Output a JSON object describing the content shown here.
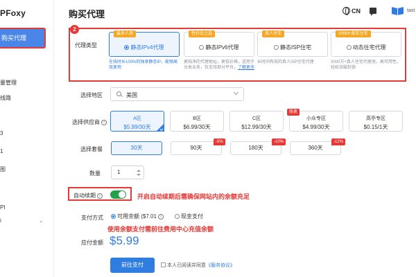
{
  "brand": {
    "logo_text": "PFoxy"
  },
  "sidebar": {
    "active_item": "购买代理",
    "items": [
      "量管理",
      "线路",
      "3",
      "1",
      "图",
      "PI",
      "i"
    ]
  },
  "header": {
    "page_title": "购买代理",
    "language": "CN",
    "user_text": "tast"
  },
  "proxy_type": {
    "label": "代理类型",
    "step_badge": "2",
    "options": [
      {
        "tag": "最多人用",
        "label": "静态IPv4代理",
        "desc": "在线时长100%的独享静态IP，能够高效使用",
        "selected": true,
        "radio": false
      },
      {
        "tag": "性价比之选",
        "label": "静态IPv6代理",
        "desc": "更纯净的代理地址，更低价格，适用于分发业务，仅支持部分平台，",
        "link": "了解更多",
        "selected": false,
        "radio": false
      },
      {
        "tag": "真人住宅",
        "label": "静态ISP住宅",
        "desc": "长时间有效的真人ISP住宅代理",
        "selected": false,
        "radio": false
      },
      {
        "tag": "200M+真实住宅",
        "label": "动态住宅代理",
        "desc": "3000万+真人住宅代理池，高可用性，轻松突破封锁",
        "selected": false,
        "radio": true
      }
    ]
  },
  "region": {
    "label": "选择地区",
    "value": "美国"
  },
  "supplier": {
    "label": "选择供应商",
    "hot_tag": "热卖",
    "options": [
      {
        "name": "A区",
        "price": "$5.99/30天",
        "selected": true
      },
      {
        "name": "B区",
        "price": "$6.99/30天",
        "selected": false
      },
      {
        "name": "C区",
        "price": "$12.99/30天",
        "selected": false
      },
      {
        "name": "小众专区",
        "price": "$4.99/30天",
        "selected": false
      },
      {
        "name": "高亭专区",
        "price": "$0.15/1天",
        "selected": false
      }
    ]
  },
  "package": {
    "label": "选择套餐",
    "options": [
      {
        "label": "30天",
        "discount": "",
        "selected": true
      },
      {
        "label": "90天",
        "discount": "-5%",
        "selected": false
      },
      {
        "label": "180天",
        "discount": "-10%",
        "selected": false
      },
      {
        "label": "360天",
        "discount": "-12%",
        "selected": false
      }
    ]
  },
  "quantity": {
    "label": "数量",
    "value": "1"
  },
  "auto_renew": {
    "label": "自动续期",
    "enabled": true,
    "annotation": "开启自动续期后需确保网站内的余额充足"
  },
  "payment": {
    "label": "支付方式",
    "balance_option": "可用余额 ($7.01",
    "cash_option": "现金支付",
    "annotation": "使用余额支付需前往费用中心充值余额"
  },
  "total": {
    "label": "应付金额",
    "amount": "$5.99"
  },
  "submit": {
    "button": "前往支付",
    "agree_text": "本人已阅读并同意",
    "agree_link": "《服务协议》"
  },
  "colors": {
    "accent": "#2f7de1",
    "annotation": "#e53935",
    "toggle_on": "#22a34a"
  }
}
